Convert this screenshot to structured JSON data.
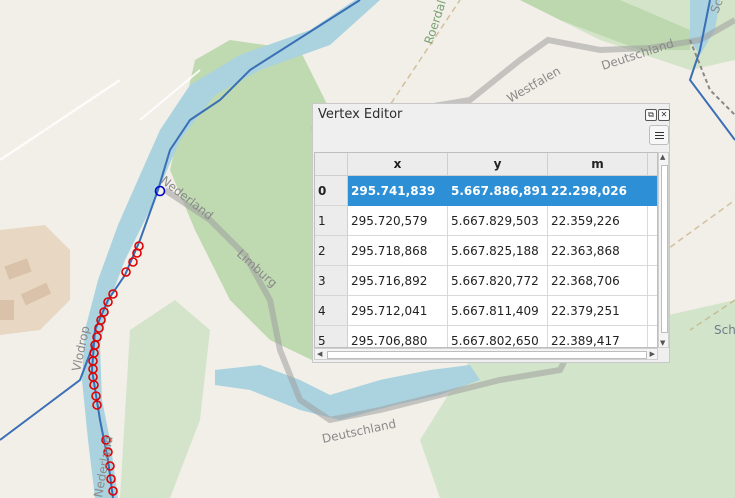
{
  "map": {
    "labels": {
      "roerdal": "Roerdal",
      "westfalen": "Westfalen",
      "deutschland_top": "Deutschland",
      "nederland_river": "Nederland",
      "limburg": "Limburg",
      "deutschland_bottom": "Deutschland",
      "vlodrop": "Vlodrop",
      "nederland_left": "Nederland",
      "sch": "Sch",
      "sc": "Sc"
    },
    "colors": {
      "background": "#f2efe9",
      "forest": "#add19e",
      "water": "#aad3df",
      "border": "#9e9e9e",
      "selected_vertex": "#0000cc",
      "vertex_markers": "#e00000",
      "line": "#3a6fb5"
    }
  },
  "vertex_editor": {
    "title": "Vertex Editor",
    "restore_label": "⧉",
    "close_label": "✕",
    "columns": [
      "x",
      "y",
      "m"
    ],
    "rows": [
      {
        "index": "0",
        "x": "295.741,839",
        "y": "5.667.886,891",
        "m": "22.298,026"
      },
      {
        "index": "1",
        "x": "295.720,579",
        "y": "5.667.829,503",
        "m": "22.359,226"
      },
      {
        "index": "2",
        "x": "295.718,868",
        "y": "5.667.825,188",
        "m": "22.363,868"
      },
      {
        "index": "3",
        "x": "295.716,892",
        "y": "5.667.820,772",
        "m": "22.368,706"
      },
      {
        "index": "4",
        "x": "295.712,041",
        "y": "5.667.811,409",
        "m": "22.379,251"
      },
      {
        "index": "5",
        "x": "295.706,880",
        "y": "5.667.802,650",
        "m": "22.389,417"
      }
    ],
    "selected_row": "0",
    "colors": {
      "selection": "#2d8fd5"
    }
  }
}
